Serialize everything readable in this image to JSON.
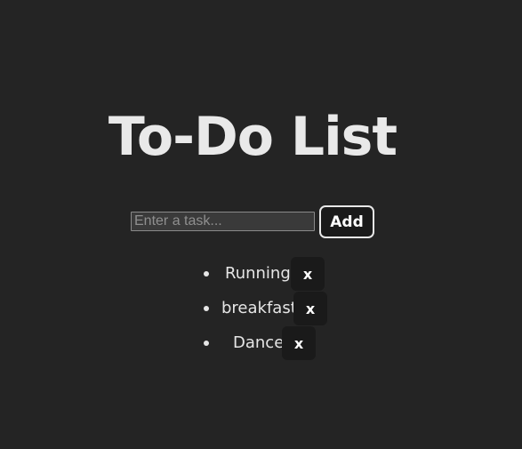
{
  "app": {
    "title": "To-Do List"
  },
  "entry": {
    "placeholder": "Enter a task...",
    "value": "",
    "add_label": "Add"
  },
  "tasks": [
    {
      "label": "Running",
      "delete_label": "x"
    },
    {
      "label": "breakfast",
      "delete_label": "x"
    },
    {
      "label": "Dance",
      "delete_label": "x"
    }
  ],
  "colors": {
    "background": "#242424",
    "text": "#e6e6e6",
    "button_background": "#1a1a1a",
    "add_button_border": "#e8e8e8"
  }
}
